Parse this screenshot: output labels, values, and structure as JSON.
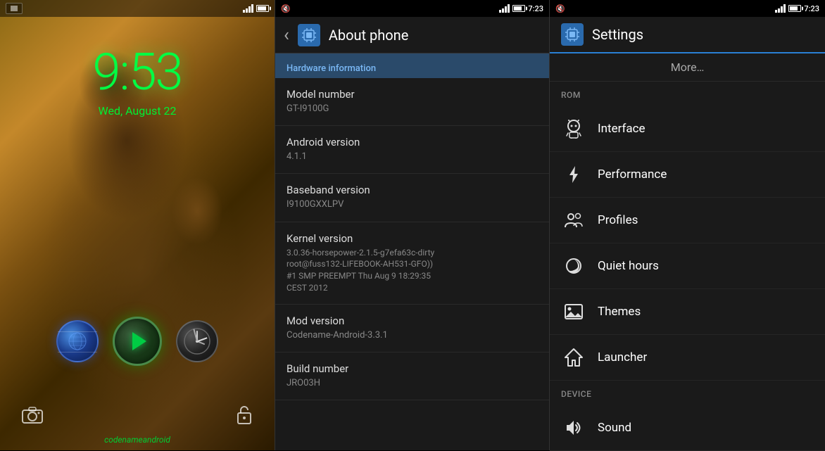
{
  "lock_screen": {
    "time": "9:53",
    "date": "Wed, August 22",
    "brand": "codenameandroid",
    "camera_icon": "📷",
    "unlock_icon": "🔒"
  },
  "about_phone": {
    "title": "About phone",
    "back_icon": "‹",
    "section_header": "Hardware information",
    "items": [
      {
        "label": "Model number",
        "value": "GT-I9100G"
      },
      {
        "label": "Android version",
        "value": "4.1.1"
      },
      {
        "label": "Baseband version",
        "value": "I9100GXXLPV"
      },
      {
        "label": "Kernel version",
        "value": "3.0.36-horsepower-2.1.5-g7efa63c-dirty\nroot@fuss132-LIFEBOOK-AH531-GFO))\n#1 SMP PREEMPT Thu Aug 9 18:29:35\nCEST 2012"
      },
      {
        "label": "Mod version",
        "value": "Codename-Android-3.3.1"
      },
      {
        "label": "Build number",
        "value": "JRO03H"
      }
    ],
    "status_bar": {
      "time": "7:23",
      "mute": true
    }
  },
  "settings": {
    "title": "Settings",
    "more_label": "More…",
    "rom_header": "ROM",
    "device_header": "DEVICE",
    "items_rom": [
      {
        "id": "interface",
        "label": "Interface",
        "icon": "interface"
      },
      {
        "id": "performance",
        "label": "Performance",
        "icon": "performance"
      },
      {
        "id": "profiles",
        "label": "Profiles",
        "icon": "profiles"
      },
      {
        "id": "quiet-hours",
        "label": "Quiet hours",
        "icon": "quiet-hours"
      },
      {
        "id": "themes",
        "label": "Themes",
        "icon": "themes"
      },
      {
        "id": "launcher",
        "label": "Launcher",
        "icon": "launcher"
      }
    ],
    "items_device": [
      {
        "id": "sound",
        "label": "Sound",
        "icon": "sound"
      }
    ],
    "status_bar": {
      "time": "7:23",
      "mute": true
    }
  },
  "colors": {
    "accent_blue": "#2a7fd4",
    "text_primary": "#ffffff",
    "text_secondary": "#888888",
    "background": "#1a1a1a",
    "item_divider": "#252525",
    "green_time": "#00ff44"
  }
}
